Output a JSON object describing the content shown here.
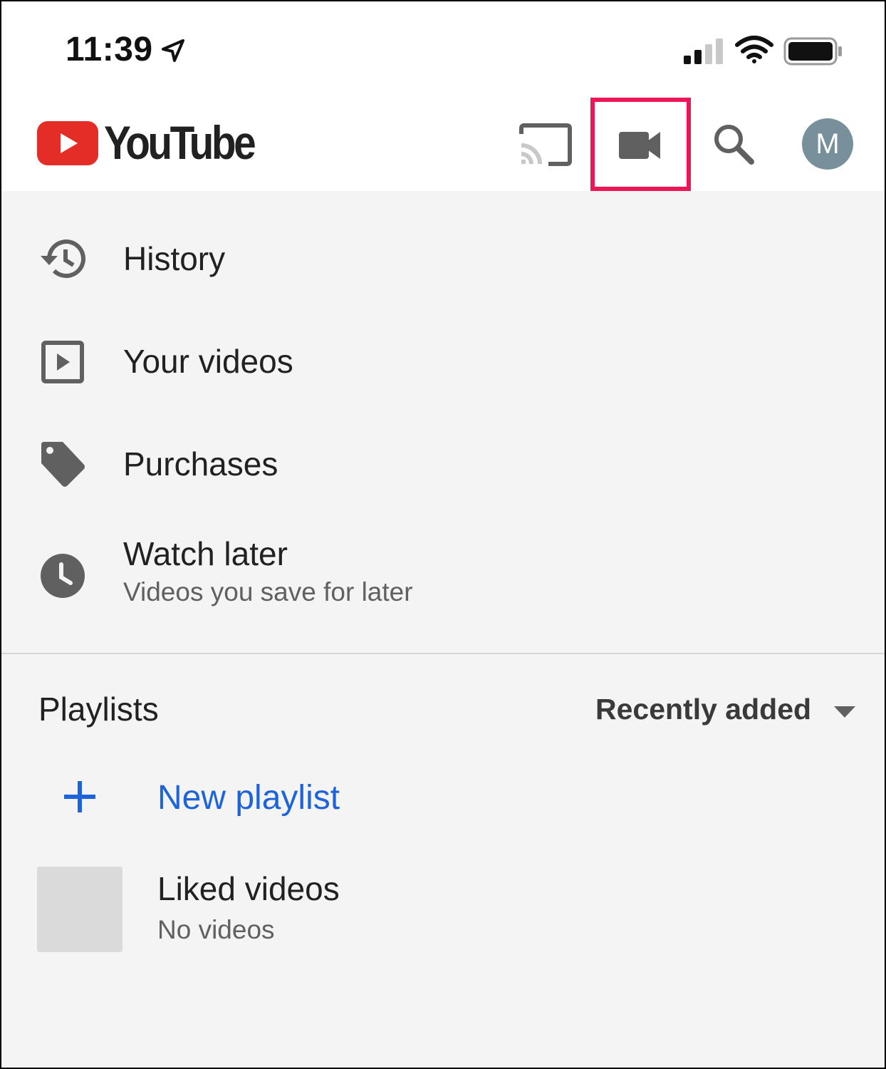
{
  "status_bar": {
    "time": "11:39",
    "icons": [
      "location-arrow-icon",
      "cellular-signal-icon",
      "wifi-icon",
      "battery-icon"
    ]
  },
  "app_bar": {
    "logo_text": "YouTube",
    "avatar_initial": "M",
    "icons": [
      "cast-icon",
      "video-camera-icon",
      "search-icon"
    ],
    "colors": {
      "brand_red": "#e52d27",
      "highlight": "#ec1756",
      "avatar_bg": "#78909c"
    }
  },
  "menu": {
    "items": [
      {
        "label": "History",
        "icon": "history-icon"
      },
      {
        "label": "Your videos",
        "icon": "play-box-icon"
      },
      {
        "label": "Purchases",
        "icon": "tag-icon"
      },
      {
        "label": "Watch later",
        "sublabel": "Videos you save for later",
        "icon": "clock-icon"
      }
    ]
  },
  "playlists": {
    "title": "Playlists",
    "sort_selected": "Recently added",
    "new_playlist_label": "New playlist",
    "new_playlist_color": "#1e63d8",
    "items": [
      {
        "title": "Liked videos",
        "subtitle": "No videos"
      }
    ]
  }
}
